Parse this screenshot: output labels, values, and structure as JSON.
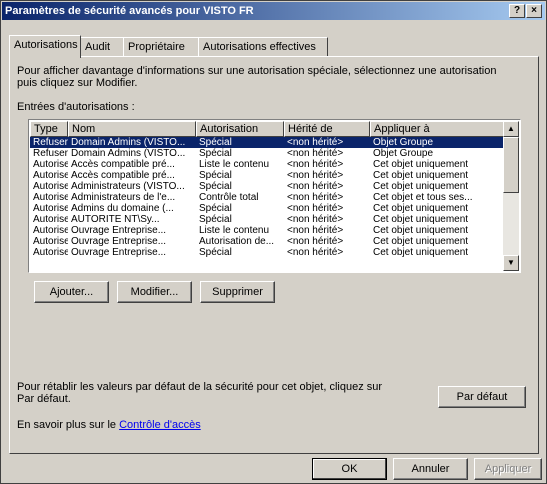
{
  "window": {
    "title": "Paramètres de sécurité avancés pour VISTO FR",
    "help_glyph": "?",
    "close_glyph": "×"
  },
  "tabs": [
    {
      "label": "Autorisations"
    },
    {
      "label": "Audit"
    },
    {
      "label": "Propriétaire"
    },
    {
      "label": "Autorisations effectives"
    }
  ],
  "description": "Pour afficher davantage d'informations sur une autorisation spéciale, sélectionnez une autorisation puis cliquez sur Modifier.",
  "list_label": "Entrées d'autorisations :",
  "columns": [
    "Type",
    "Nom",
    "Autorisation",
    "Hérité de",
    "Appliquer à"
  ],
  "rows": [
    {
      "type": "Refuser",
      "name": "Domain Admins (VISTO...",
      "permission": "Spécial",
      "inherited": "<non hérité>",
      "apply": "Objet Groupe",
      "selected": true
    },
    {
      "type": "Refuser",
      "name": "Domain Admins (VISTO...",
      "permission": "Spécial",
      "inherited": "<non hérité>",
      "apply": "Objet Groupe",
      "selected": false
    },
    {
      "type": "Autoriser",
      "name": "Accès compatible pré...",
      "permission": "Liste le contenu",
      "inherited": "<non hérité>",
      "apply": "Cet objet uniquement",
      "selected": false
    },
    {
      "type": "Autoriser",
      "name": "Accès compatible pré...",
      "permission": "Spécial",
      "inherited": "<non hérité>",
      "apply": "Cet objet uniquement",
      "selected": false
    },
    {
      "type": "Autoriser",
      "name": "Administrateurs (VISTO...",
      "permission": "Spécial",
      "inherited": "<non hérité>",
      "apply": "Cet objet uniquement",
      "selected": false
    },
    {
      "type": "Autoriser",
      "name": "Administrateurs de l'e...",
      "permission": "Contrôle total",
      "inherited": "<non hérité>",
      "apply": "Cet objet et tous ses...",
      "selected": false
    },
    {
      "type": "Autoriser",
      "name": "Admins du domaine (...",
      "permission": "Spécial",
      "inherited": "<non hérité>",
      "apply": "Cet objet uniquement",
      "selected": false
    },
    {
      "type": "Autoriser",
      "name": "AUTORITE NT\\Sy...",
      "permission": "Spécial",
      "inherited": "<non hérité>",
      "apply": "Cet objet uniquement",
      "selected": false
    },
    {
      "type": "Autoriser",
      "name": "Ouvrage Entreprise...",
      "permission": "Liste le contenu",
      "inherited": "<non hérité>",
      "apply": "Cet objet uniquement",
      "selected": false
    },
    {
      "type": "Autoriser",
      "name": "Ouvrage Entreprise...",
      "permission": "Autorisation de...",
      "inherited": "<non hérité>",
      "apply": "Cet objet uniquement",
      "selected": false
    },
    {
      "type": "Autoriser",
      "name": "Ouvrage Entreprise...",
      "permission": "Spécial",
      "inherited": "<non hérité>",
      "apply": "Cet objet uniquement",
      "selected": false
    }
  ],
  "buttons": {
    "add": "Ajouter...",
    "edit": "Modifier...",
    "remove": "Supprimer",
    "default": "Par défaut",
    "ok": "OK",
    "cancel": "Annuler",
    "apply": "Appliquer"
  },
  "bottom_text": "Pour rétablir les valeurs par défaut de la sécurité pour cet objet, cliquez sur Par défaut.",
  "more_prefix": "En savoir plus sur le ",
  "more_link": "Contrôle d'accès",
  "scroll": {
    "up": "▲",
    "down": "▼"
  }
}
